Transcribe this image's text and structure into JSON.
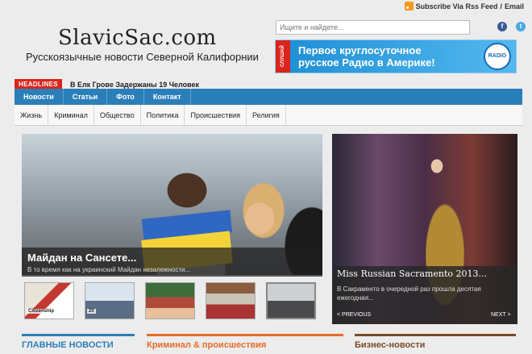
{
  "header": {
    "rss_label": "Subscribe Via Rss Feed",
    "separator": "/",
    "email_label": "Email",
    "logo": "SlavicSac.com",
    "tagline": "Русскоязычные новости Северной Калифорнии",
    "search_placeholder": "Ищите и найдете..."
  },
  "banner": {
    "tag": "СЛУШАЙ",
    "text_line1": "Первое круглосуточное",
    "text_line2": "русское Радио в Америке!",
    "logo": "RADIO"
  },
  "ticker": {
    "label": "HEADLINES",
    "text": "В Елк Грове Задержаны 19 Человек"
  },
  "nav": {
    "items": [
      "Новости",
      "Статьи",
      "Фото",
      "Контакт"
    ]
  },
  "subnav": {
    "items": [
      "Жизнь",
      "Криминал",
      "Общество",
      "Политика",
      "Происшествия",
      "Религия"
    ]
  },
  "hero": {
    "title": "Майдан на Сансете...",
    "subtitle": "В то время как на украинский Майдан незалежности..."
  },
  "thumbs": [
    {
      "caption": "Citizenship"
    },
    {
      "caption": "20"
    },
    {
      "caption": ""
    },
    {
      "caption": ""
    },
    {
      "caption": ""
    }
  ],
  "side": {
    "title": "Miss Russian Sacramento 2013...",
    "subtitle": "В Сакраменто в очередной раз прошла десятая ежегодная...",
    "prev": "< PREVIOUS",
    "next": "NEXT >"
  },
  "categories": [
    "ГЛАВНЫЕ НОВОСТИ",
    "Криминал & происшествия",
    "Бизнес-новости"
  ],
  "colors": {
    "nav_blue": "#2b7fb9",
    "headline_red": "#d9261c",
    "crime_orange": "#e86b2a",
    "business_brown": "#7a4a27"
  }
}
